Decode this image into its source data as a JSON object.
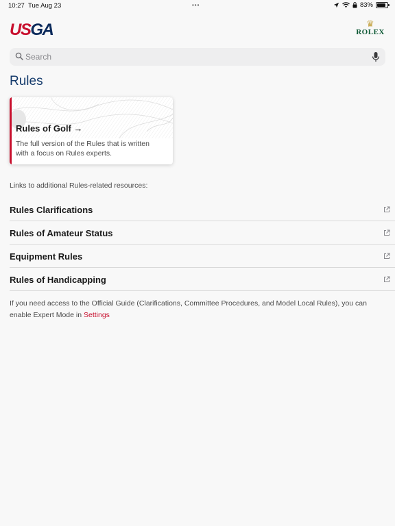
{
  "status_bar": {
    "time": "10:27",
    "date": "Tue Aug 23",
    "dots": "•••",
    "battery": "83%",
    "battery_level": 0.83
  },
  "header": {
    "logo_us": "US",
    "logo_ga": "GA",
    "partner_crown": "♛",
    "partner_text": "ROLEX"
  },
  "search": {
    "placeholder": "Search"
  },
  "page": {
    "title": "Rules"
  },
  "card": {
    "title": "Rules of Golf",
    "arrow": "→",
    "description": "The full version of the Rules that is written with a focus on Rules experts."
  },
  "links": {
    "intro": "Links to additional Rules-related resources:",
    "items": [
      {
        "label": "Rules Clarifications"
      },
      {
        "label": "Rules of Amateur Status"
      },
      {
        "label": "Equipment Rules"
      },
      {
        "label": "Rules of Handicapping"
      }
    ]
  },
  "footer": {
    "text": "If you need access to the Official Guide (Clarifications, Committee Procedures, and Model Local Rules), you can enable Expert Mode in ",
    "settings_link": "Settings"
  },
  "colors": {
    "accent_red": "#c8102e",
    "brand_navy": "#143a6b",
    "rolex_green": "#0f5a36",
    "rolex_gold": "#c7a64a"
  }
}
